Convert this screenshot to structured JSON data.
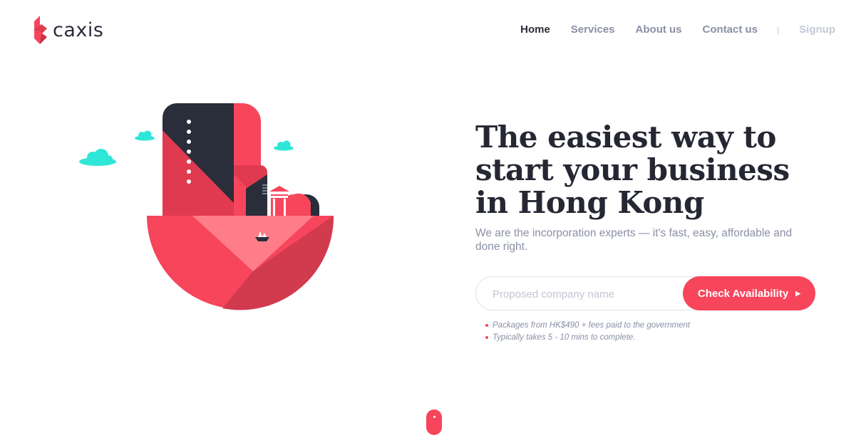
{
  "brand": {
    "name": "caxis",
    "logo_icon": "caxis-logo-icon",
    "accent": "#f7455c",
    "dark": "#2a2d3a",
    "teal": "#2ee6d8"
  },
  "nav": {
    "items": [
      {
        "label": "Home",
        "active": true
      },
      {
        "label": "Services",
        "active": false
      },
      {
        "label": "About us",
        "active": false
      },
      {
        "label": "Contact us",
        "active": false
      }
    ],
    "separator": "|",
    "signup": "Signup"
  },
  "hero": {
    "title": "The easiest way to start your business in Hong Kong",
    "subtitle": "We are the incorporation experts — it's fast, easy, affordable and done right."
  },
  "search": {
    "placeholder": "Proposed company name",
    "value": "",
    "button_label": "Check Availability",
    "button_icon": "chevron-right-icon"
  },
  "notes": [
    "Packages from HK$490 + fees paid to the government",
    "Typically takes 5 - 10 mins to complete."
  ],
  "scroll_indicator": "mouse-scroll-icon"
}
